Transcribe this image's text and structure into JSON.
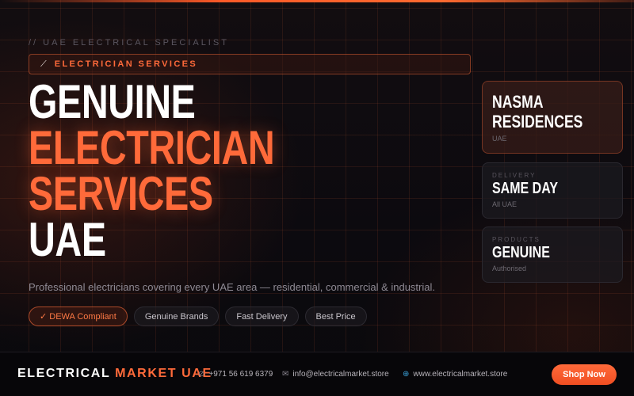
{
  "hero": {
    "kicker": "// UAE ELECTRICAL SPECIALIST",
    "service_pill": {
      "icon": "wrench-icon",
      "label": "ELECTRICIAN SERVICES"
    },
    "headline": {
      "line1": "GENUINE",
      "line2": "ELECTRICIAN",
      "line3": "SERVICES",
      "line4": "UAE"
    },
    "description": "Professional electricians covering every UAE area — residential, commercial & industrial.",
    "tags": [
      {
        "label": "✓ DEWA Compliant",
        "active": true
      },
      {
        "label": "Genuine Brands",
        "active": false
      },
      {
        "label": "Fast Delivery",
        "active": false
      },
      {
        "label": "Best Price",
        "active": false
      }
    ]
  },
  "cards": [
    {
      "caption": "",
      "title_line1": "NASMA",
      "title_line2": "RESIDENCES",
      "sub": "UAE"
    },
    {
      "caption": "DELIVERY",
      "title_line1": "SAME DAY",
      "sub": "All UAE"
    },
    {
      "caption": "PRODUCTS",
      "title_line1": "GENUINE",
      "sub": "Authorised"
    }
  ],
  "footer": {
    "brand_part1": "ELECTRICAL",
    "brand_part2": "MARKET UAE",
    "phone": "+971 56 619 6379",
    "email": "info@electricalmarket.store",
    "website": "www.electricalmarket.store",
    "shop_button": "Shop Now"
  },
  "colors": {
    "accent": "#ff6a3a",
    "background": "#0b0a10",
    "footer": "#070609"
  }
}
